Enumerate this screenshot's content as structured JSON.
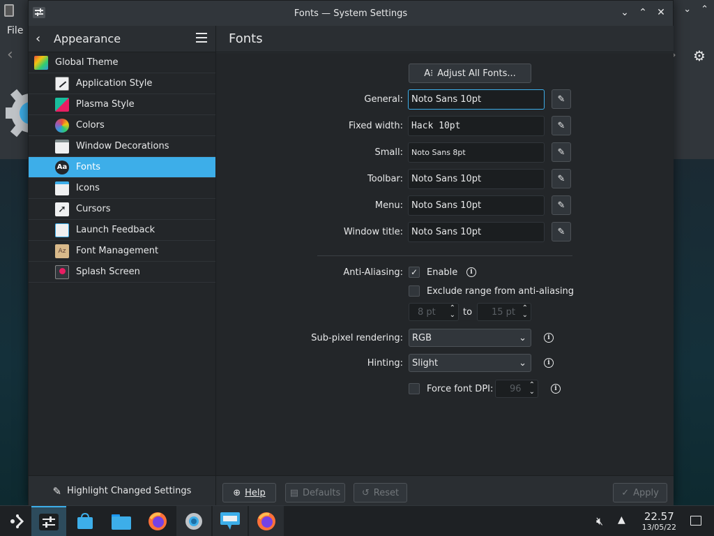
{
  "background": {
    "file_menu": "File"
  },
  "window": {
    "title": "Fonts — System Settings"
  },
  "sidebar": {
    "header_title": "Appearance",
    "items": [
      {
        "label": "Global Theme",
        "level": "top"
      },
      {
        "label": "Application Style",
        "level": "child"
      },
      {
        "label": "Plasma Style",
        "level": "child"
      },
      {
        "label": "Colors",
        "level": "child"
      },
      {
        "label": "Window Decorations",
        "level": "child"
      },
      {
        "label": "Fonts",
        "level": "child",
        "active": true
      },
      {
        "label": "Icons",
        "level": "child"
      },
      {
        "label": "Cursors",
        "level": "child"
      },
      {
        "label": "Launch Feedback",
        "level": "child"
      },
      {
        "label": "Font Management",
        "level": "child"
      },
      {
        "label": "Splash Screen",
        "level": "child"
      }
    ],
    "highlight_label": "Highlight Changed Settings"
  },
  "main": {
    "title": "Fonts",
    "adjust_all_label": "Adjust All Fonts...",
    "fonts": {
      "general": {
        "label": "General:",
        "value": "Noto Sans 10pt"
      },
      "fixed": {
        "label": "Fixed width:",
        "value": "Hack 10pt"
      },
      "small": {
        "label": "Small:",
        "value": "Noto Sans 8pt"
      },
      "toolbar": {
        "label": "Toolbar:",
        "value": "Noto Sans 10pt"
      },
      "menu": {
        "label": "Menu:",
        "value": "Noto Sans 10pt"
      },
      "window_title": {
        "label": "Window title:",
        "value": "Noto Sans 10pt"
      }
    },
    "antialiasing": {
      "label": "Anti-Aliasing:",
      "enable_label": "Enable",
      "enable_checked": true,
      "exclude_label": "Exclude range from anti-aliasing",
      "exclude_checked": false,
      "range_from": "8 pt",
      "range_to_label": "to",
      "range_to": "15 pt"
    },
    "subpixel": {
      "label": "Sub-pixel rendering:",
      "value": "RGB"
    },
    "hinting": {
      "label": "Hinting:",
      "value": "Slight"
    },
    "force_dpi": {
      "label": "Force font DPI:",
      "checked": false,
      "value": "96"
    }
  },
  "footer": {
    "help": "Help",
    "defaults": "Defaults",
    "reset": "Reset",
    "apply": "Apply"
  },
  "taskbar": {
    "time": "22.57",
    "date": "13/05/22"
  },
  "colors": {
    "accent": "#3daee9",
    "window_bg": "#2a2e32",
    "view_bg": "#232629"
  }
}
